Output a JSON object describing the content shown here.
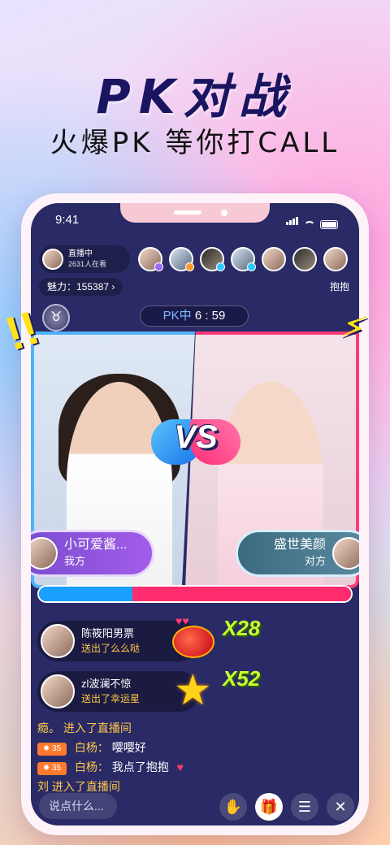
{
  "promo": {
    "headline": "PK对战",
    "subline": "火爆PK 等你打CALL"
  },
  "status": {
    "time": "9:41"
  },
  "host": {
    "title": "直播中",
    "viewers": "2631人在看"
  },
  "charm": {
    "label": "魅力：155387 ›"
  },
  "hug_label": "抱抱",
  "pk": {
    "label": "PK中",
    "timer": "6 : 59"
  },
  "vs_label": "VS",
  "sides": {
    "left": {
      "name": "小可爱酱...",
      "role": "我方"
    },
    "right": {
      "name": "盛世美颜",
      "role": "对方"
    }
  },
  "score": {
    "left_fraction": 0.3
  },
  "gifts": [
    {
      "name": "陈筱阳男票",
      "action": "送出了么么哒",
      "multiplier": "X28"
    },
    {
      "name": "zl波澜不惊",
      "action": "送出了幸运星",
      "multiplier": "X52"
    }
  ],
  "chat": [
    {
      "user": "瘾。",
      "text": "进入了直播间"
    },
    {
      "level": "35",
      "user": "白杨：",
      "text": "嘤嘤好"
    },
    {
      "level": "35",
      "user": "白杨：",
      "text": "我点了抱抱"
    },
    {
      "user": "刘",
      "text": "进入了直播间"
    }
  ],
  "input": {
    "placeholder": "说点什么..."
  },
  "colors": {
    "blue_side": "#1aa0ff",
    "red_side": "#ff2d6e",
    "accent_yellow": "#ffc84a"
  }
}
